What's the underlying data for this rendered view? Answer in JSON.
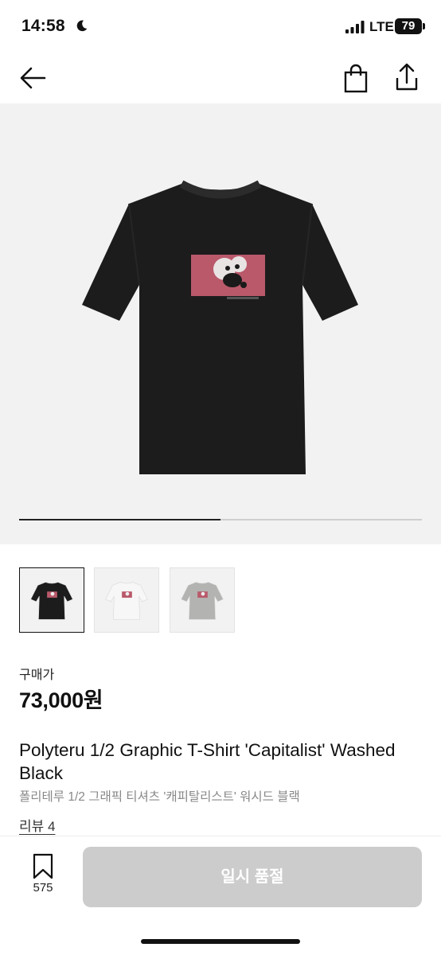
{
  "status_bar": {
    "time": "14:58",
    "network": "LTE",
    "battery": "79"
  },
  "nav": {
    "icons": [
      "back-arrow-icon",
      "shopping-bag-icon",
      "share-icon"
    ]
  },
  "gallery": {
    "progress": 0.5,
    "thumbnails": [
      {
        "color_name": "black",
        "shirt_color": "#1c1c1c",
        "active": true
      },
      {
        "color_name": "white",
        "shirt_color": "#f7f7f7",
        "active": false
      },
      {
        "color_name": "gray",
        "shirt_color": "#b3b3b1",
        "active": false
      }
    ]
  },
  "product": {
    "price_label": "구매가",
    "price": "73,000원",
    "title": "Polyteru 1/2 Graphic T-Shirt 'Capitalist' Washed Black",
    "subtitle": "폴리테루 1/2 그래픽 티셔츠 '캐피탈리스트' 워시드 블랙",
    "review_link": "리뷰 4"
  },
  "bottom_bar": {
    "wishlist_count": "575",
    "soldout_label": "일시 품절"
  },
  "colors": {
    "accent": "#111111",
    "disabled_button": "#cccccc",
    "hero_bg": "#f2f2f2",
    "graphic_pink": "#b9596a"
  }
}
